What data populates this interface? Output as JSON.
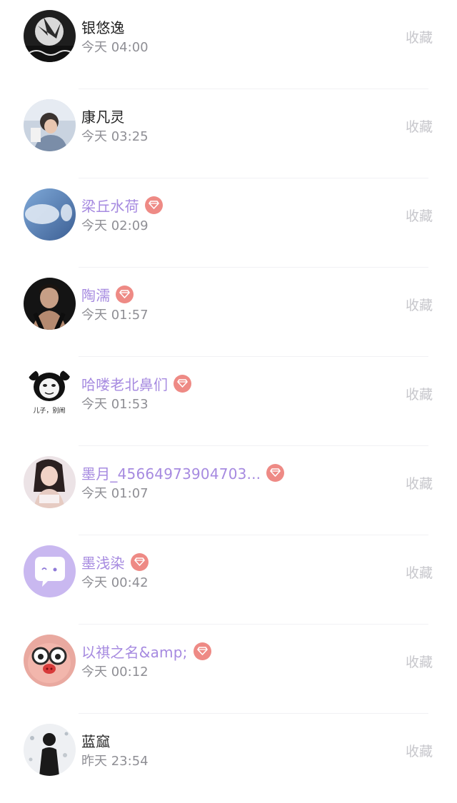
{
  "items": [
    {
      "name": "银悠逸",
      "time": "今天 04:00",
      "action": "收藏",
      "vip": false,
      "avatar": "avatar-dark-graffiti"
    },
    {
      "name": "康凡灵",
      "time": "今天 03:25",
      "action": "收藏",
      "vip": false,
      "avatar": "avatar-boy-reading"
    },
    {
      "name": "梁丘水荷",
      "time": "今天 02:09",
      "action": "收藏",
      "vip": true,
      "avatar": "avatar-sky-blur"
    },
    {
      "name": "陶濡",
      "time": "今天 01:57",
      "action": "收藏",
      "vip": true,
      "avatar": "avatar-man-portrait"
    },
    {
      "name": "哈喽老北鼻们",
      "time": "今天 01:53",
      "action": "收藏",
      "vip": true,
      "avatar": "avatar-panda-meme",
      "avatar_caption": "儿子，别闹"
    },
    {
      "name": "墨月_45664973904703...",
      "time": "今天 01:07",
      "action": "收藏",
      "vip": true,
      "avatar": "avatar-girl-portrait"
    },
    {
      "name": "墨浅染",
      "time": "今天 00:42",
      "action": "收藏",
      "vip": true,
      "avatar": "avatar-chat-bubble-default"
    },
    {
      "name": "以祺之名&amp;",
      "time": "今天 00:12",
      "action": "收藏",
      "vip": true,
      "avatar": "avatar-cartoon-pig-glasses"
    },
    {
      "name": "蓝窳",
      "time": "昨天 23:54",
      "action": "收藏",
      "vip": false,
      "avatar": "avatar-man-snow"
    }
  ],
  "colors": {
    "vip_name": "#a68ae0",
    "vip_badge": "#ee8a85",
    "normal_name": "#222222",
    "time_text": "#8f8f95",
    "action_text": "#c7c7cc"
  }
}
